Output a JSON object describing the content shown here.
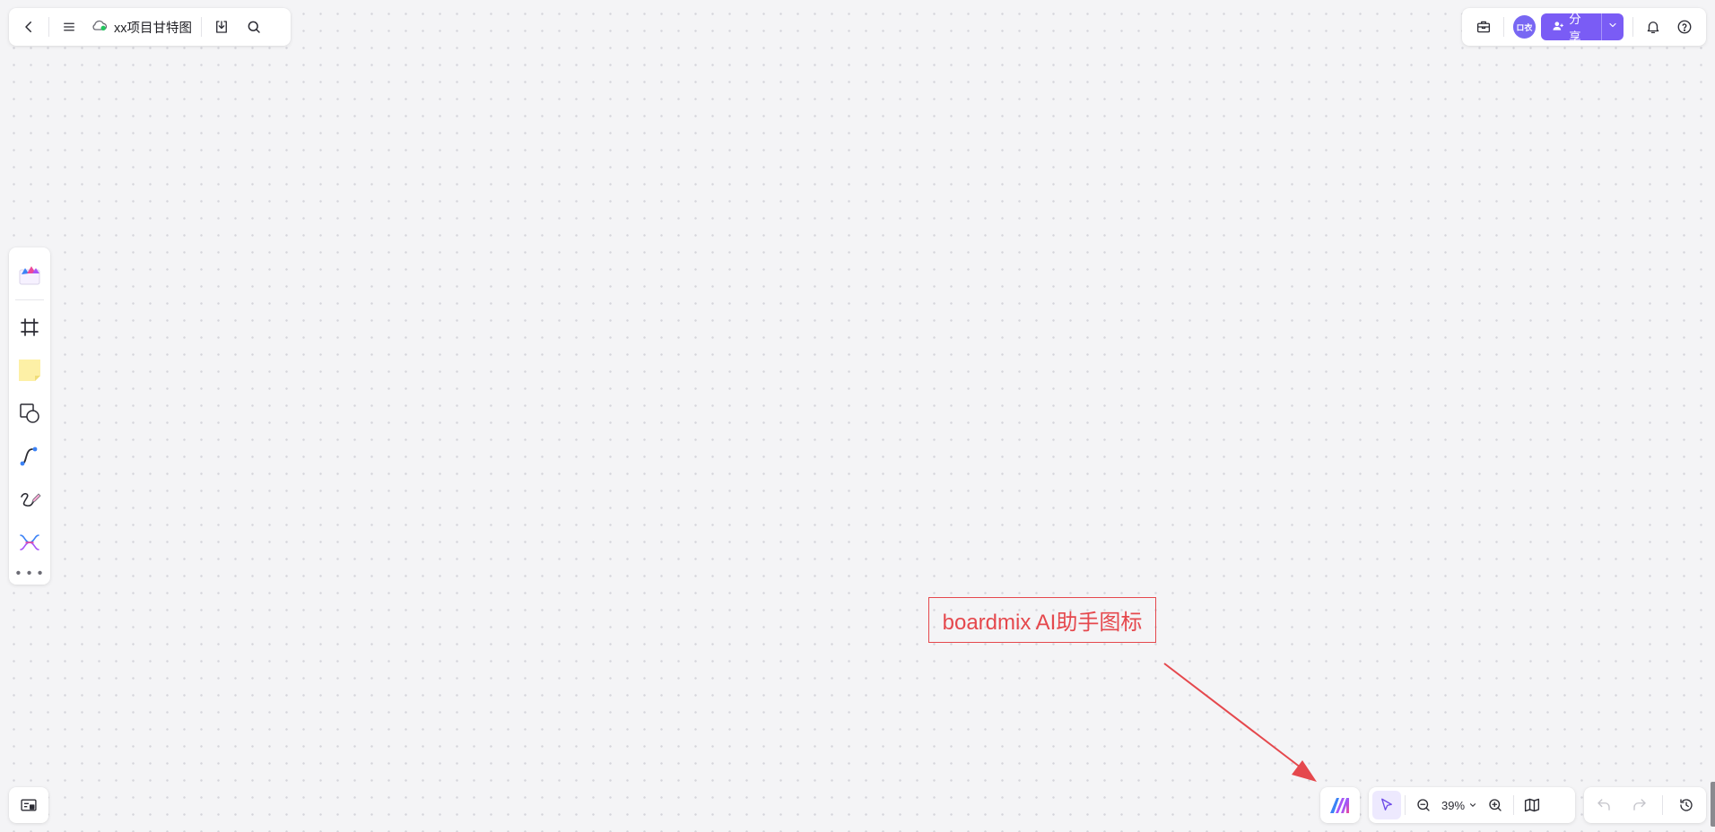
{
  "topbar_left": {
    "back_icon": "chevron-left-icon",
    "menu_icon": "hamburger-menu-icon",
    "cloud_status_icon": "cloud-saved-icon",
    "document_title": "xx项目甘特图",
    "download_icon": "download-icon",
    "search_icon": "search-icon"
  },
  "topbar_right": {
    "toolbox_icon": "toolbox-icon",
    "avatar_text": "ロ衣",
    "share_label": "分享",
    "share_icon": "user-plus-icon",
    "notification_icon": "bell-icon",
    "help_icon": "help-circle-icon"
  },
  "left_toolbar": {
    "items": [
      {
        "name": "template-library",
        "icon": "template-library-icon"
      },
      {
        "name": "frame",
        "icon": "frame-icon"
      },
      {
        "name": "sticky-note",
        "icon": "sticky-note-icon"
      },
      {
        "name": "shapes",
        "icon": "shapes-icon"
      },
      {
        "name": "connector",
        "icon": "connector-line-icon"
      },
      {
        "name": "pen",
        "icon": "pen-draw-icon"
      },
      {
        "name": "mind-map",
        "icon": "mind-map-icon"
      },
      {
        "name": "more",
        "icon": "more-dots-icon"
      }
    ]
  },
  "bottom_left": {
    "minimap_icon": "minimap-icon"
  },
  "bottom_right": {
    "ai_icon": "boardmix-ai-icon",
    "select_icon": "cursor-select-icon",
    "zoom_out_icon": "zoom-out-icon",
    "zoom_level": "39%",
    "zoom_in_icon": "zoom-in-icon",
    "map_icon": "map-view-icon",
    "undo_icon": "undo-icon",
    "redo_icon": "redo-icon",
    "history_icon": "history-icon"
  },
  "annotation": {
    "label": "boardmix AI助手图标",
    "color": "#e5484d"
  },
  "colors": {
    "accent": "#7a5cf5",
    "avatar": "#7867f3",
    "canvas": "#f4f4f6"
  }
}
